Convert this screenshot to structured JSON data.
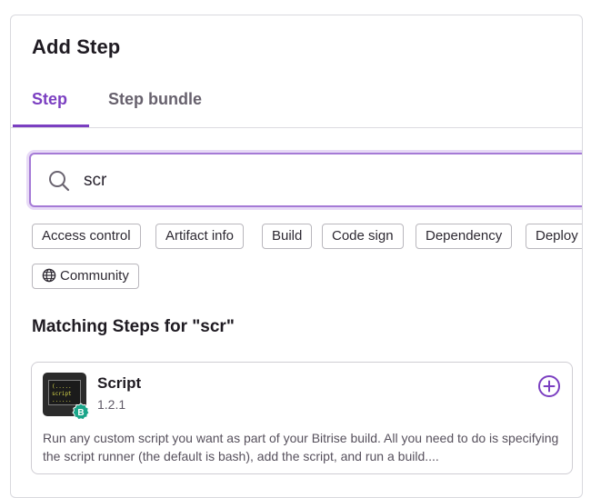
{
  "dialog": {
    "title": "Add Step"
  },
  "tabs": [
    {
      "label": "Step",
      "active": true
    },
    {
      "label": "Step bundle",
      "active": false
    }
  ],
  "search": {
    "value": "scr",
    "icon": "search-icon"
  },
  "filters": {
    "chips": [
      "Access control",
      "Artifact info",
      "Build",
      "Code sign",
      "Dependency",
      "Deploy"
    ],
    "community_label": "Community",
    "community_icon": "globe-icon"
  },
  "results": {
    "heading": "Matching Steps for \"scr\"",
    "steps": [
      {
        "name": "Script",
        "version": "1.2.1",
        "description": "Run any custom script you want as part of your Bitrise build. All you need to do is specifying the script runner (the default is bash), add the script, and run a build....",
        "icon": "script-step-icon",
        "badge_letter": "B",
        "icon_code": [
          "(.....",
          "script",
          "......"
        ]
      }
    ]
  },
  "colors": {
    "accent": "#7b3fc1",
    "badge": "#1aa589",
    "search_border": "#a57ad6"
  }
}
